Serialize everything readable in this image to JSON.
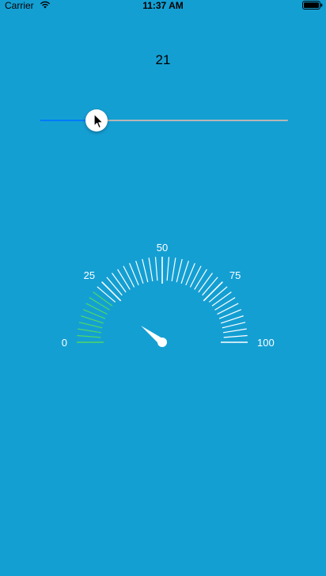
{
  "status_bar": {
    "carrier": "Carrier",
    "time": "11:37 AM",
    "wifi_icon": "wifi-icon",
    "battery_icon": "battery-icon"
  },
  "value_display": "21",
  "slider": {
    "min": 0,
    "max": 100,
    "value": 21,
    "fill_color": "#007AFF",
    "track_color": "#B7B7B7"
  },
  "gauge": {
    "min": 0,
    "max": 100,
    "value": 21,
    "labels": [
      "0",
      "25",
      "50",
      "75",
      "100"
    ],
    "highlight_color": "#4CD964",
    "tick_color": "#FFFFFF",
    "needle_color": "#FFFFFF"
  },
  "colors": {
    "background": "#149FD3"
  }
}
